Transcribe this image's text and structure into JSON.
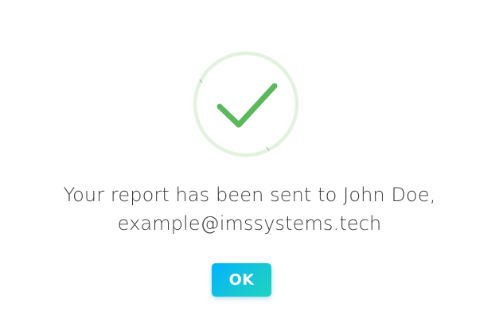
{
  "dialog": {
    "icon": "success-check-icon",
    "message_line1": "Your report has been sent to John Doe,",
    "message_line2": "example@imssystems.tech",
    "ok_label": "OK"
  },
  "colors": {
    "check": "#5cb85c",
    "ring": "#e3f2df",
    "button_gradient_start": "#00b2ff",
    "button_gradient_end": "#1fd3bf",
    "text": "#3b3b3b"
  }
}
